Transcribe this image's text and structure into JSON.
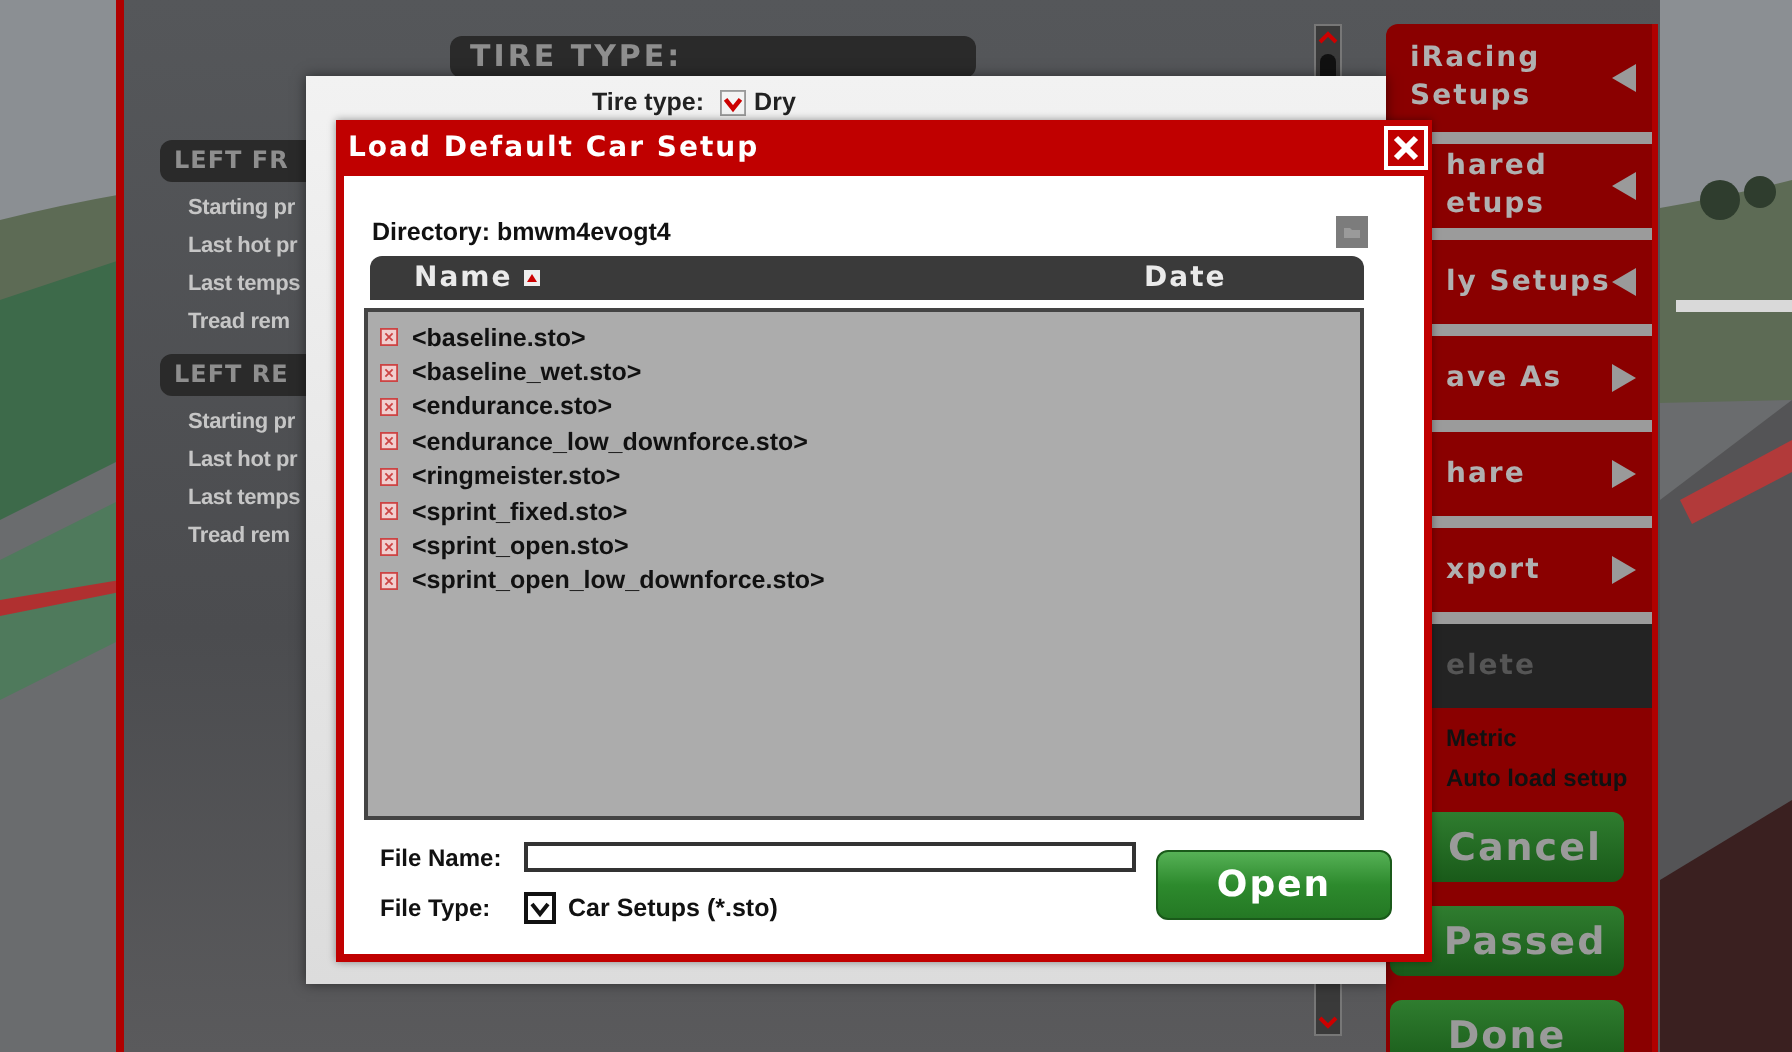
{
  "background_panel": {
    "header": "TIRE TYPE:",
    "sections": [
      {
        "title": "LEFT FR",
        "rows": [
          "Starting pr",
          "Last hot pr",
          "Last temps",
          "Tread rem"
        ]
      },
      {
        "title": "LEFT RE",
        "rows": [
          "Starting pr",
          "Last hot pr",
          "Last temps",
          "Tread rem"
        ]
      }
    ]
  },
  "tire_type": {
    "label": "Tire type:",
    "value": "Dry"
  },
  "side_menu": {
    "items": [
      {
        "lines": [
          "iRacing",
          "Setups"
        ],
        "kind": "submenu"
      },
      {
        "lines": [
          "hared",
          "etups"
        ],
        "kind": "submenu"
      },
      {
        "lines": [
          "ly Setups"
        ],
        "kind": "submenu"
      },
      {
        "lines": [
          "ave As"
        ],
        "kind": "action"
      },
      {
        "lines": [
          "hare"
        ],
        "kind": "action"
      },
      {
        "lines": [
          "xport"
        ],
        "kind": "action"
      },
      {
        "lines": [
          "elete"
        ],
        "kind": "disabled"
      }
    ],
    "options": [
      "Metric",
      "Auto load setup"
    ],
    "buttons": [
      "Cancel",
      "Passed",
      "Done"
    ]
  },
  "dialog": {
    "title": "Load Default Car Setup",
    "directory_label": "Directory:",
    "directory": "bmwm4evogt4",
    "columns": [
      {
        "label": "Name",
        "sorted": true
      },
      {
        "label": "Date",
        "sorted": false
      }
    ],
    "files": [
      "<baseline.sto>",
      "<baseline_wet.sto>",
      "<endurance.sto>",
      "<endurance_low_downforce.sto>",
      "<ringmeister.sto>",
      "<sprint_fixed.sto>",
      "<sprint_open.sto>",
      "<sprint_open_low_downforce.sto>"
    ],
    "file_name": {
      "label": "File Name:"
    },
    "file_type": {
      "label": "File Type:",
      "value": "Car Setups (*.sto)",
      "checked": true
    },
    "open_button": "Open"
  }
}
